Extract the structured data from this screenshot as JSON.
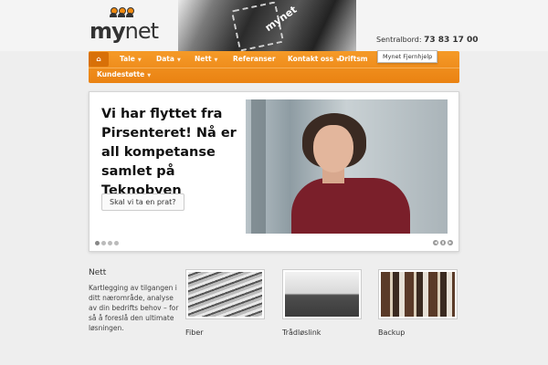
{
  "header": {
    "logo_my": "my",
    "logo_net": "net",
    "photo_logo": "mynet",
    "phone_label": "Sentralbord:",
    "phone_number": "73 83 17 00"
  },
  "nav": {
    "items": [
      {
        "label": "Tale"
      },
      {
        "label": "Data"
      },
      {
        "label": "Nett"
      },
      {
        "label": "Referanser"
      },
      {
        "label": "Kontakt oss"
      },
      {
        "label": "Driftsm"
      },
      {
        "label": "Kundestøtte"
      }
    ],
    "tooltip": "Mynet Fjernhjelp"
  },
  "slider": {
    "heading": "Vi har flyttet fra Pirsenteret! Nå er all kompetanse samlet på Teknobyen",
    "button": "Skal vi ta en prat?"
  },
  "nett": {
    "title": "Nett",
    "description": "Kartlegging av tilgangen i ditt nærområde, analyse av din bedrifts behov – for så å foreslå den ultimate løsningen."
  },
  "thumbnails": [
    {
      "label": "Fiber"
    },
    {
      "label": "Trådløslink"
    },
    {
      "label": "Backup"
    }
  ],
  "colors": {
    "accent": "#f08a12",
    "nav_active": "#d87008",
    "background": "#eeeeee"
  }
}
